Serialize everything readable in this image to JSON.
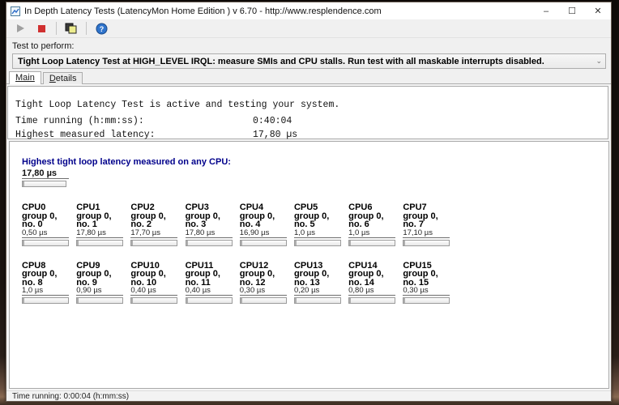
{
  "window": {
    "title": "In Depth Latency Tests  (LatencyMon Home Edition )  v 6.70 - http://www.resplendence.com",
    "controls": {
      "minimize_glyph": "–",
      "maximize_glyph": "☐",
      "close_glyph": "✕"
    }
  },
  "toolbar": {
    "play_icon": "play-icon",
    "stop_icon": "stop-icon",
    "copy_icon": "copy-icon",
    "help_icon": "help-icon",
    "help_glyph": "?"
  },
  "test_section": {
    "label": "Test to perform:",
    "selected_option": "Tight Loop Latency Test at HIGH_LEVEL IRQL:  measure SMIs and CPU stalls. Run test with all maskable interrupts disabled.",
    "dropdown_arrow": "⌄"
  },
  "tabs": [
    {
      "label": "Main"
    },
    {
      "label": "Details"
    }
  ],
  "output": {
    "line1": "Tight Loop Latency Test is active and testing your system.",
    "rows": [
      {
        "label": "Time running (h:mm:ss):",
        "value": "0:40:04"
      },
      {
        "label": "Highest measured latency:",
        "value": "17,80 µs"
      }
    ]
  },
  "chart": {
    "header": "Highest tight loop latency measured on any CPU:",
    "highest_value": "17,80 µs",
    "cpus": [
      {
        "name": "CPU0",
        "group": "group 0,",
        "no": "no. 0",
        "value": "0,50 µs"
      },
      {
        "name": "CPU1",
        "group": "group 0,",
        "no": "no. 1",
        "value": "17,80 µs"
      },
      {
        "name": "CPU2",
        "group": "group 0,",
        "no": "no. 2",
        "value": "17,70 µs"
      },
      {
        "name": "CPU3",
        "group": "group 0,",
        "no": "no. 3",
        "value": "17,80 µs"
      },
      {
        "name": "CPU4",
        "group": "group 0,",
        "no": "no. 4",
        "value": "16,90 µs"
      },
      {
        "name": "CPU5",
        "group": "group 0,",
        "no": "no. 5",
        "value": "1,0 µs"
      },
      {
        "name": "CPU6",
        "group": "group 0,",
        "no": "no. 6",
        "value": "1,0 µs"
      },
      {
        "name": "CPU7",
        "group": "group 0,",
        "no": "no. 7",
        "value": "17,10 µs"
      },
      {
        "name": "CPU8",
        "group": "group 0,",
        "no": "no. 8",
        "value": "1,0 µs"
      },
      {
        "name": "CPU9",
        "group": "group 0,",
        "no": "no. 9",
        "value": "0,90 µs"
      },
      {
        "name": "CPU10",
        "group": "group 0,",
        "no": "no. 10",
        "value": "0,40 µs"
      },
      {
        "name": "CPU11",
        "group": "group 0,",
        "no": "no. 11",
        "value": "0,40 µs"
      },
      {
        "name": "CPU12",
        "group": "group 0,",
        "no": "no. 12",
        "value": "0,30 µs"
      },
      {
        "name": "CPU13",
        "group": "group 0,",
        "no": "no. 13",
        "value": "0,20 µs"
      },
      {
        "name": "CPU14",
        "group": "group 0,",
        "no": "no. 14",
        "value": "0,80 µs"
      },
      {
        "name": "CPU15",
        "group": "group 0,",
        "no": "no. 15",
        "value": "0,30 µs"
      }
    ]
  },
  "statusbar": {
    "text": "Time running: 0:00:04  (h:mm:ss)"
  }
}
